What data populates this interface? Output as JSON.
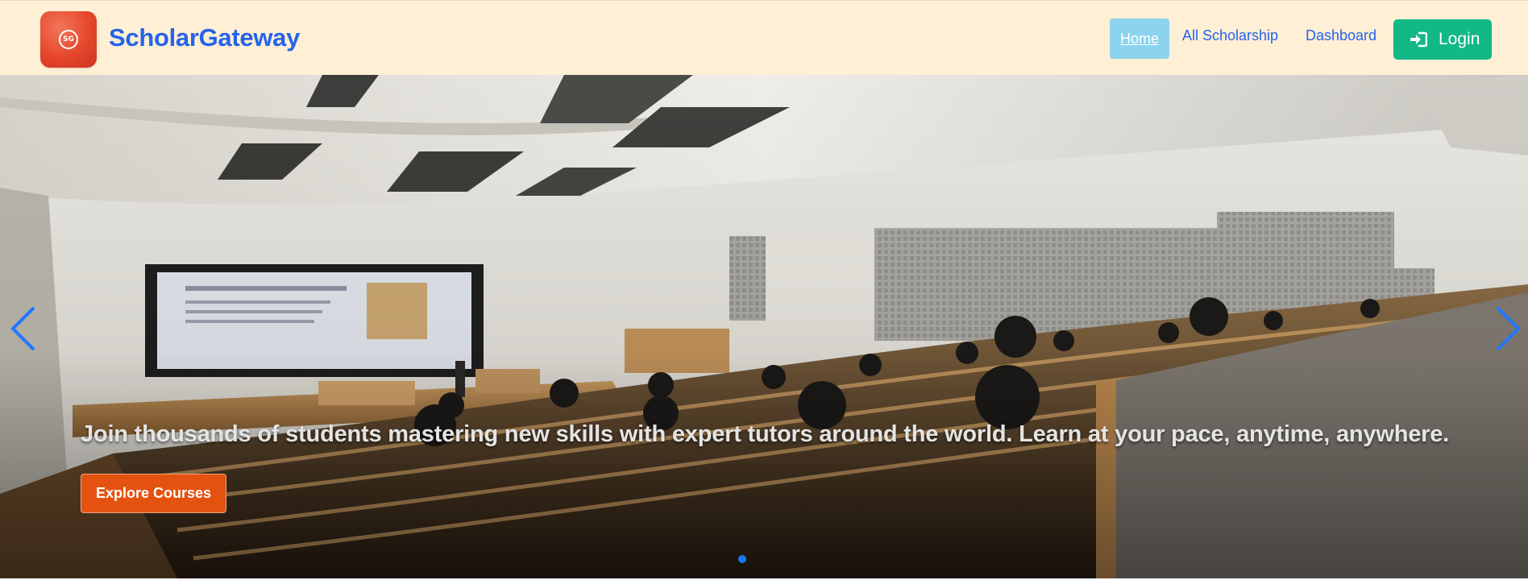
{
  "logo": {
    "initials": "SG"
  },
  "brand": "ScholarGateway",
  "nav": {
    "home": "Home",
    "all_scholarship": "All Scholarship",
    "dashboard": "Dashboard",
    "login": "Login",
    "login_icon": "sign-in-icon"
  },
  "hero": {
    "headline": "Join thousands of students mastering new skills with expert tutors around the world. Learn at your pace, anytime, anywhere.",
    "cta": "Explore Courses",
    "prev_icon": "chevron-left-icon",
    "next_icon": "chevron-right-icon",
    "slide_count": 1,
    "active_slide": 1
  },
  "colors": {
    "navbar_bg": "#ffefd5",
    "brand": "#2563eb",
    "home_pill": "#8bd3ee",
    "login_bg": "#12b886",
    "cta_bg": "#e4520f",
    "indicator": "#1877f2"
  }
}
